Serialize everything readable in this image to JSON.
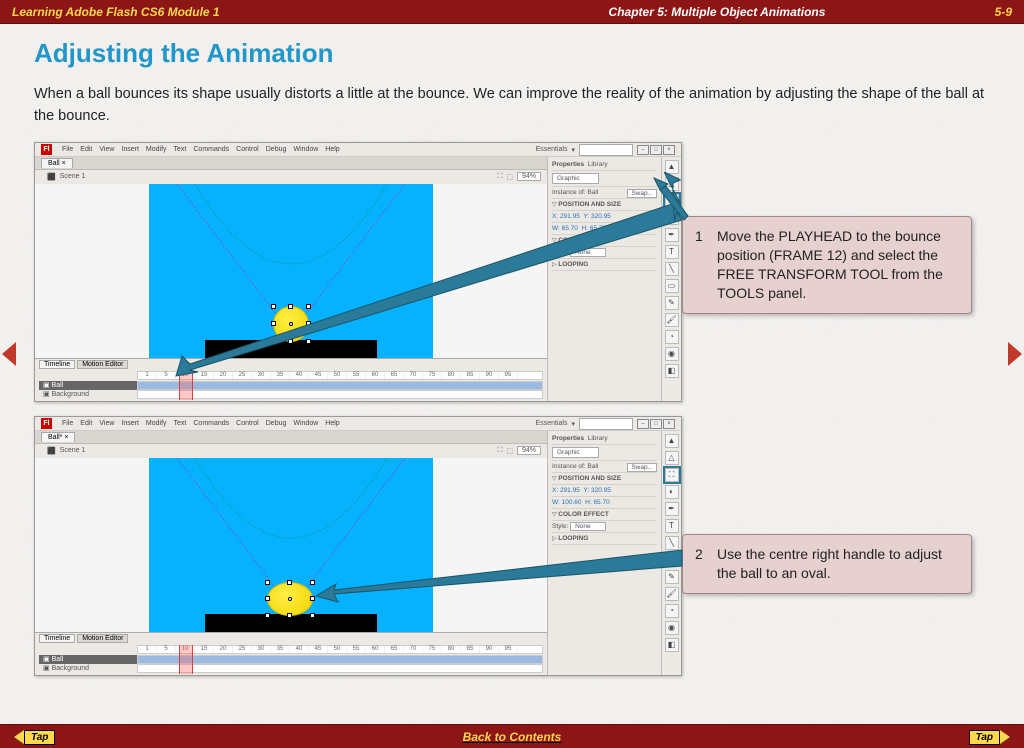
{
  "header": {
    "left": "Learning Adobe Flash CS6 Module 1",
    "center": "Chapter 5: Multiple Object Animations",
    "right": "5-9"
  },
  "title": "Adjusting the Animation",
  "intro": "When a ball bounces its shape usually distorts a little at the bounce.  We can improve the reality of the animation by adjusting the shape of the ball at the bounce.",
  "callouts": [
    {
      "num": "1",
      "text": "Move the PLAYHEAD to the bounce position (FRAME 12) and select the FREE TRANSFORM TOOL from the TOOLS panel."
    },
    {
      "num": "2",
      "text": "Use the centre right handle to adjust the ball to an oval."
    }
  ],
  "flash": {
    "menu": [
      "File",
      "Edit",
      "View",
      "Insert",
      "Modify",
      "Text",
      "Commands",
      "Control",
      "Debug",
      "Window",
      "Help"
    ],
    "workspace": "Essentials",
    "tab1": "Ball  ×",
    "tab2": "Ball*  ×",
    "scene": "Scene 1",
    "zoom": "94%",
    "panel": {
      "tabs": [
        "Properties",
        "Library"
      ],
      "type": "Graphic",
      "instance": "Instance of: Ball",
      "swap": "Swap...",
      "possize": "POSITION AND SIZE",
      "x": "X: 291.95",
      "y": "Y: 320.95",
      "w": "W: 65.70",
      "h": "H: 65.70",
      "coloreffect": "COLOR EFFECT",
      "style": "Style:",
      "none": "None",
      "looping": "LOOPING"
    },
    "timeline": {
      "tabs": [
        "Timeline",
        "Motion Editor"
      ],
      "layers": [
        "Ball",
        "Background"
      ],
      "marks": [
        "1",
        "5",
        "10",
        "15",
        "20",
        "25",
        "30",
        "35",
        "40",
        "45",
        "50",
        "55",
        "60",
        "65",
        "70",
        "75",
        "80",
        "85",
        "90",
        "95"
      ]
    }
  },
  "footer": {
    "link": "Back to Contents",
    "tap": "Tap"
  }
}
